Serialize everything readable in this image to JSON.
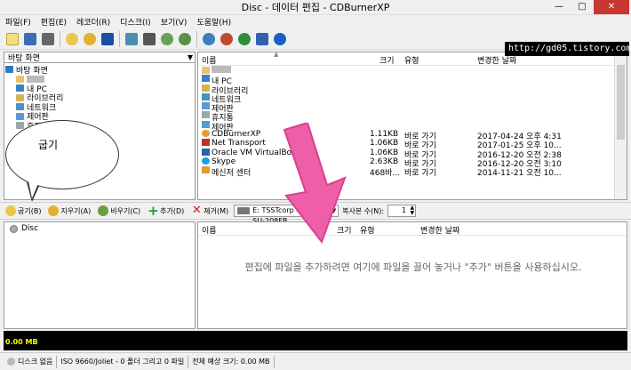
{
  "window": {
    "title": "Disc - 데이터 편집 - CDBurnerXP",
    "minimize": "—",
    "maximize": "□",
    "close": "✕"
  },
  "menu": [
    "파일(F)",
    "편집(E)",
    "레코더(R)",
    "디스크(I)",
    "보기(V)",
    "도움말(H)"
  ],
  "watermark": "http://gd05.tistory.com",
  "tree": {
    "combo_value": "바탕 화면",
    "nodes": [
      {
        "label": "바탕 화면",
        "indent": 0,
        "icon": "desktop-icon"
      },
      {
        "label": "",
        "indent": 1,
        "icon": "user-folder-icon",
        "blurred": true
      },
      {
        "label": "내 PC",
        "indent": 1,
        "icon": "computer-icon"
      },
      {
        "label": "라이브러리",
        "indent": 1,
        "icon": "library-icon"
      },
      {
        "label": "네트워크",
        "indent": 1,
        "icon": "network-icon"
      },
      {
        "label": "제어판",
        "indent": 1,
        "icon": "control-panel-icon"
      },
      {
        "label": "휴지통",
        "indent": 1,
        "icon": "recycle-bin-icon"
      }
    ]
  },
  "bubble_label": "굽기",
  "files": {
    "columns": [
      "이름",
      "크기",
      "유형",
      "변경한 날짜"
    ],
    "rows": [
      {
        "name": "",
        "size": "",
        "type": "",
        "date": "",
        "icon": "user-folder-icon",
        "blurred": true
      },
      {
        "name": "내 PC",
        "size": "",
        "type": "",
        "date": "",
        "icon": "computer-icon"
      },
      {
        "name": "라이브러리",
        "size": "",
        "type": "",
        "date": "",
        "icon": "library-icon"
      },
      {
        "name": "네트워크",
        "size": "",
        "type": "",
        "date": "",
        "icon": "network-icon"
      },
      {
        "name": "제어판",
        "size": "",
        "type": "",
        "date": "",
        "icon": "control-panel-icon"
      },
      {
        "name": "휴지통",
        "size": "",
        "type": "",
        "date": "",
        "icon": "recycle-bin-icon"
      },
      {
        "name": "제어판",
        "size": "",
        "type": "",
        "date": "",
        "icon": "control-panel-icon"
      },
      {
        "name": "CDBurnerXP",
        "size": "1.11KB",
        "type": "바로 가기",
        "date": "2017-04-24 오후 4:31",
        "icon": "cdburnerxp-icon"
      },
      {
        "name": "Net Transport",
        "size": "1.06KB",
        "type": "바로 가기",
        "date": "2017-01-25 오후 10...",
        "icon": "net-transport-icon"
      },
      {
        "name": "Oracle VM VirtualBox",
        "size": "1.06KB",
        "type": "바로 가기",
        "date": "2016-12-20 오전 2:38",
        "icon": "virtualbox-icon"
      },
      {
        "name": "Skype",
        "size": "2.63KB",
        "type": "바로 가기",
        "date": "2016-12-20 오전 3:10",
        "icon": "skype-icon"
      },
      {
        "name": "메신저 센터",
        "size": "468바...",
        "type": "바로 가기",
        "date": "2014-11-21 오전 10...",
        "icon": "messenger-icon"
      }
    ]
  },
  "toolbar2": {
    "burn": "굽기(B)",
    "erase": "지우기(A)",
    "clear": "비우기(C)",
    "add": "추가(D)",
    "remove": "제거(M)",
    "drive": "E: TSSTcorp CDDVDW SU-208FB",
    "copies_label": "복사본 수(N):",
    "copies_value": "1"
  },
  "disc": {
    "label": "Disc"
  },
  "compilation": {
    "columns": [
      "이름",
      "크기",
      "유형",
      "변경한 날짜"
    ],
    "empty_message": "편집에 파일을 추가하려면 여기에 파일을 끌어 놓거나 \"추가\" 버튼을 사용하십시오."
  },
  "capacity": {
    "text": "0.00 MB"
  },
  "status": {
    "disc": "디스크 없음",
    "format": "ISO 9660/Joliet - 0 폴더 그리고 0 파일",
    "total": "전체 예상 크기: 0.00 MB"
  },
  "colors": {
    "arrow": "#ef5fa7",
    "capacity_bg": "#000000",
    "capacity_text": "#ffff00",
    "close_btn": "#c7372f"
  }
}
